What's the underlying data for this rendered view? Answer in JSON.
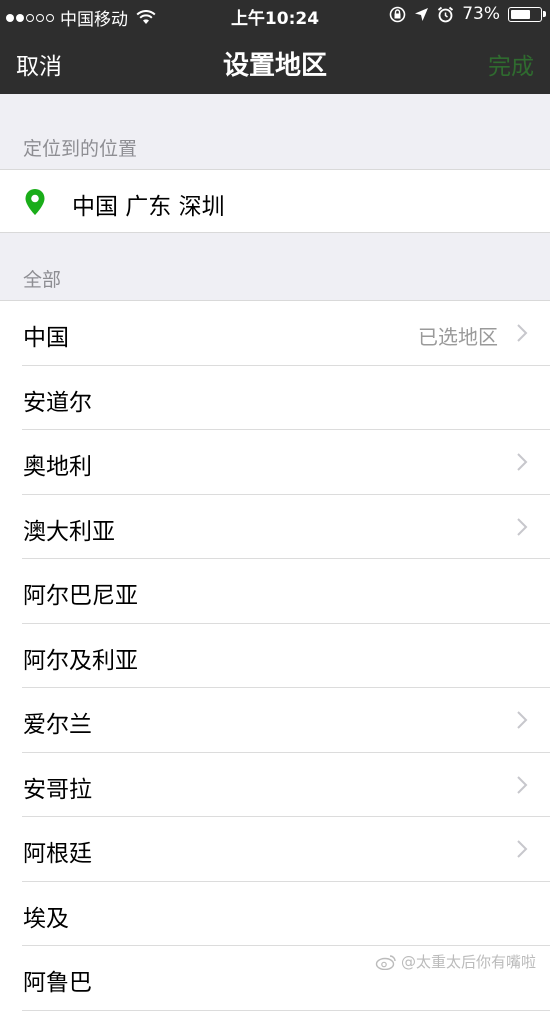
{
  "status_bar": {
    "signal_filled": 2,
    "signal_total": 5,
    "carrier": "中国移动",
    "time": "上午10:24",
    "battery_percent": "73%",
    "battery_level": 0.73
  },
  "nav": {
    "cancel_label": "取消",
    "title": "设置地区",
    "done_label": "完成"
  },
  "located_section": {
    "header": "定位到的位置",
    "location": "中国 广东 深圳",
    "pin_color": "#1aad19"
  },
  "all_section": {
    "header": "全部",
    "items": [
      {
        "label": "中国",
        "detail": "已选地区",
        "chevron": true
      },
      {
        "label": "安道尔",
        "detail": "",
        "chevron": false
      },
      {
        "label": "奥地利",
        "detail": "",
        "chevron": true
      },
      {
        "label": "澳大利亚",
        "detail": "",
        "chevron": true
      },
      {
        "label": "阿尔巴尼亚",
        "detail": "",
        "chevron": false
      },
      {
        "label": "阿尔及利亚",
        "detail": "",
        "chevron": false
      },
      {
        "label": "爱尔兰",
        "detail": "",
        "chevron": true
      },
      {
        "label": "安哥拉",
        "detail": "",
        "chevron": true
      },
      {
        "label": "阿根廷",
        "detail": "",
        "chevron": true
      },
      {
        "label": "埃及",
        "detail": "",
        "chevron": false
      },
      {
        "label": "阿鲁巴",
        "detail": "",
        "chevron": false
      }
    ]
  },
  "watermark": {
    "text": "@太重太后你有嘴啦",
    "icon": "weibo-icon"
  }
}
